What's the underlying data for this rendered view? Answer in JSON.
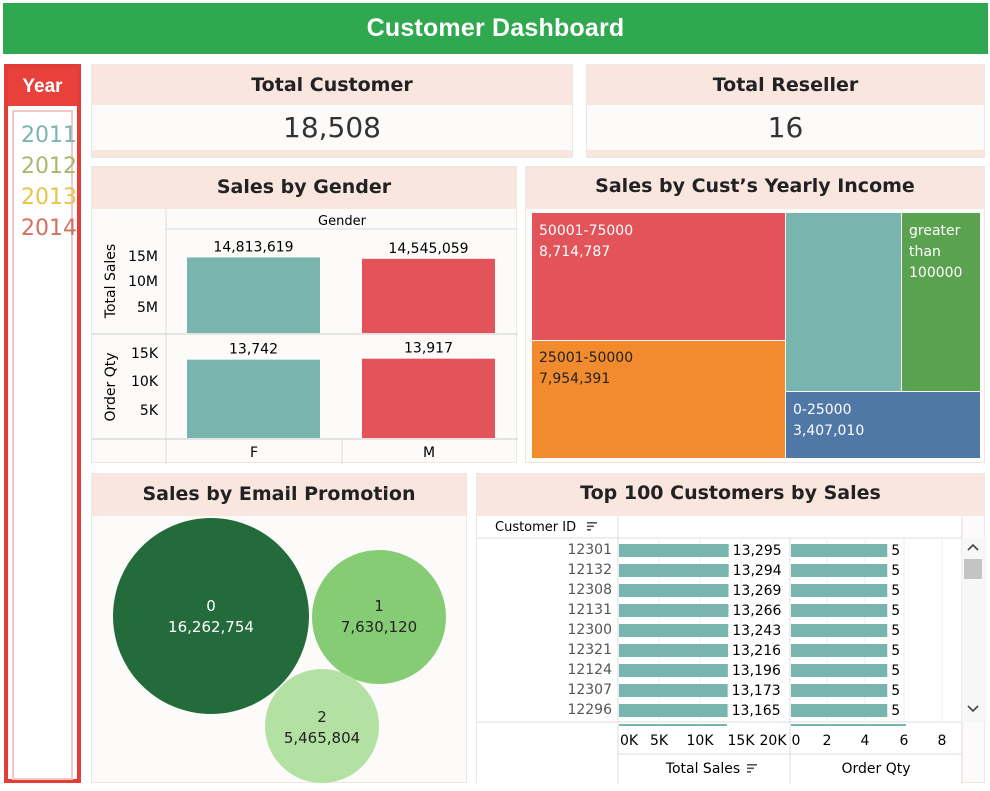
{
  "header": {
    "title": "Customer Dashboard"
  },
  "year_filter": {
    "title": "Year",
    "items": [
      {
        "label": "2011",
        "color": "#7ab5b0"
      },
      {
        "label": "2012",
        "color": "#a8b86d"
      },
      {
        "label": "2013",
        "color": "#e6c44d"
      },
      {
        "label": "2014",
        "color": "#d66f5e"
      }
    ]
  },
  "kpi_customer": {
    "title": "Total Customer",
    "value": "18,508"
  },
  "kpi_reseller": {
    "title": "Total Reseller",
    "value": "16"
  },
  "gender": {
    "title": "Sales by Gender",
    "column_header": "Gender",
    "sales_axis_label": "Total Sales",
    "qty_axis_label": "Order Qty",
    "sales_ticks": [
      "15M",
      "10M",
      "5M"
    ],
    "qty_ticks": [
      "15K",
      "10K",
      "5K"
    ],
    "categories": [
      "F",
      "M"
    ]
  },
  "income": {
    "title": "Sales by Cust’s Yearly Income",
    "cells": [
      {
        "label": "50001-75000",
        "value": "8,714,787"
      },
      {
        "label": "25001-50000",
        "value": "7,954,391"
      },
      {
        "label": "0-25000",
        "value": "3,407,010"
      },
      {
        "label_lines": [
          "greater",
          "than",
          "100000"
        ]
      }
    ]
  },
  "email": {
    "title": "Sales by Email Promotion",
    "bubbles": [
      {
        "label": "0",
        "value": "16,262,754",
        "color": "#246b3c"
      },
      {
        "label": "1",
        "value": "7,630,120",
        "color": "#86cc74"
      },
      {
        "label": "2",
        "value": "5,465,804",
        "color": "#b3e0a3"
      }
    ]
  },
  "top100": {
    "title": "Top 100 Customers by Sales",
    "id_header": "Customer ID",
    "sales_axis_title": "Total Sales",
    "qty_axis_title": "Order Qty",
    "sales_ticks": [
      "0K",
      "5K",
      "10K",
      "15K",
      "20K"
    ],
    "qty_ticks": [
      "0",
      "2",
      "4",
      "6",
      "8"
    ],
    "bar_color": "#78b5af"
  },
  "chart_data": [
    {
      "type": "bar",
      "title": "Sales by Gender",
      "categories": [
        "F",
        "M"
      ],
      "series": [
        {
          "name": "Total Sales",
          "values": [
            14813619,
            14545059
          ],
          "ylim": [
            0,
            17000000
          ]
        },
        {
          "name": "Order Qty",
          "values": [
            13742,
            13917
          ],
          "ylim": [
            0,
            17000
          ]
        }
      ],
      "value_labels_sales": [
        "14,813,619",
        "14,545,059"
      ],
      "value_labels_qty": [
        "13,742",
        "13,917"
      ],
      "colors": [
        "#78b5af",
        "#e2535a"
      ],
      "xlabel": "Gender"
    },
    {
      "type": "bar",
      "title": "Top 100 Customers by Sales",
      "categories": [
        "12301",
        "12132",
        "12308",
        "12131",
        "12300",
        "12321",
        "12124",
        "12307",
        "12296"
      ],
      "series": [
        {
          "name": "Total Sales",
          "values": [
            13295,
            13294,
            13269,
            13266,
            13243,
            13216,
            13196,
            13173,
            13165
          ],
          "xlim": [
            0,
            20000
          ]
        },
        {
          "name": "Order Qty",
          "values": [
            5,
            5,
            5,
            5,
            5,
            5,
            5,
            5,
            5
          ],
          "xlim": [
            0,
            8
          ]
        }
      ],
      "value_labels_sales": [
        "13,295",
        "13,294",
        "13,269",
        "13,266",
        "13,243",
        "13,216",
        "13,196",
        "13,173",
        "13,165"
      ]
    }
  ]
}
